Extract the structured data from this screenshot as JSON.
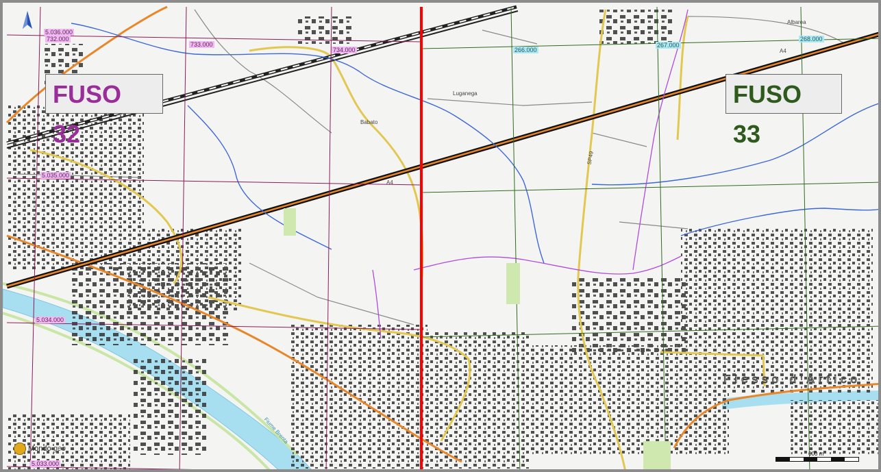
{
  "zones": {
    "left": {
      "label": "FUSO 32",
      "color": "#9b2d9b"
    },
    "right": {
      "label": "FUSO 33",
      "color": "#2f5a1e"
    }
  },
  "grid_labels_zone32": {
    "northing": [
      "5.036.000",
      "5.035.000",
      "5.034.000",
      "5.033.000"
    ],
    "easting": [
      "732.000",
      "733.000",
      "734.000"
    ]
  },
  "grid_labels_zone33": {
    "easting": [
      "266.000",
      "267.000",
      "268.000"
    ]
  },
  "places": {
    "albarea": "Albarea",
    "luganega": "Luganega",
    "babato": "Babato",
    "a4_right": "A4",
    "a4_left": "A4",
    "sp49": "SP49",
    "fiume_brenta": "Fiume Brenta",
    "fiesso_artico": "Fiesso d'Artico"
  },
  "logo": {
    "main": "Mondo",
    "suffix": "geo"
  },
  "scale": {
    "label": "600 m"
  },
  "colors": {
    "zone32_grid": "#8b1a5a",
    "zone33_grid": "#2f6a1e",
    "boundary": "#ff0000",
    "highway": "#e8862a",
    "river": "#a8dff0"
  }
}
